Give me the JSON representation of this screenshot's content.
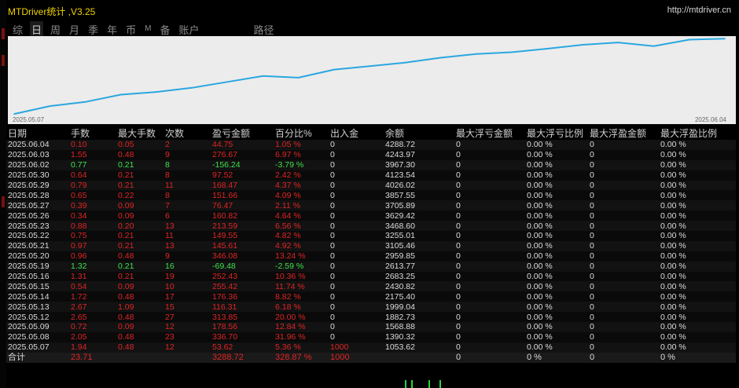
{
  "app": {
    "title": "MTDriver统计 ,V3.25",
    "site": "http://mtdriver.cn"
  },
  "tabs": [
    "综",
    "日",
    "周",
    "月",
    "季",
    "年",
    "币",
    "M",
    "备",
    "账户",
    "路径"
  ],
  "active_tab": "日",
  "chart_data": {
    "type": "line",
    "title": "",
    "x_start_label": "2025.05.07",
    "x_end_label": "2025.06.04",
    "x": [
      "2025.05.07",
      "2025.05.08",
      "2025.05.09",
      "2025.05.12",
      "2025.05.13",
      "2025.05.14",
      "2025.05.15",
      "2025.05.16",
      "2025.05.19",
      "2025.05.20",
      "2025.05.21",
      "2025.05.22",
      "2025.05.23",
      "2025.05.26",
      "2025.05.27",
      "2025.05.28",
      "2025.05.29",
      "2025.05.30",
      "2025.06.02",
      "2025.06.03",
      "2025.06.04"
    ],
    "values": [
      1053.62,
      1390.32,
      1568.88,
      1882.73,
      1999.04,
      2175.4,
      2430.82,
      2683.25,
      2613.77,
      2959.85,
      3105.46,
      3255.01,
      3468.6,
      3629.42,
      3705.89,
      3857.55,
      4026.02,
      4123.54,
      3967.3,
      4243.97,
      4288.72
    ],
    "line_color": "#2aa7e0",
    "background": "#ececec"
  },
  "table": {
    "columns": [
      "日期",
      "手数",
      "最大手数",
      "次数",
      "盈亏金额",
      "百分比%",
      "出入金",
      "余额",
      "最大浮亏金额",
      "最大浮亏比例",
      "最大浮盈金额",
      "最大浮盈比例"
    ],
    "rows": [
      [
        "2025.06.04",
        "0.10",
        "0.05",
        "2",
        "44.75",
        "1.05 %",
        "0",
        "4288.72",
        "0",
        "0.00 %",
        "0",
        "0.00 %"
      ],
      [
        "2025.06.03",
        "1.55",
        "0.48",
        "9",
        "276.67",
        "6.97 %",
        "0",
        "4243.97",
        "0",
        "0.00 %",
        "0",
        "0.00 %"
      ],
      [
        "2025.06.02",
        "0.77",
        "0.21",
        "8",
        "-156.24",
        "-3.79 %",
        "0",
        "3967.30",
        "0",
        "0.00 %",
        "0",
        "0.00 %"
      ],
      [
        "2025.05.30",
        "0.64",
        "0.21",
        "8",
        "97.52",
        "2.42 %",
        "0",
        "4123.54",
        "0",
        "0.00 %",
        "0",
        "0.00 %"
      ],
      [
        "2025.05.29",
        "0.79",
        "0.21",
        "11",
        "168.47",
        "4.37 %",
        "0",
        "4026.02",
        "0",
        "0.00 %",
        "0",
        "0.00 %"
      ],
      [
        "2025.05.28",
        "0.65",
        "0.22",
        "8",
        "151.66",
        "4.09 %",
        "0",
        "3857.55",
        "0",
        "0.00 %",
        "0",
        "0.00 %"
      ],
      [
        "2025.05.27",
        "0.39",
        "0.09",
        "7",
        "76.47",
        "2.11 %",
        "0",
        "3705.89",
        "0",
        "0.00 %",
        "0",
        "0.00 %"
      ],
      [
        "2025.05.26",
        "0.34",
        "0.09",
        "6",
        "160.82",
        "4.64 %",
        "0",
        "3629.42",
        "0",
        "0.00 %",
        "0",
        "0.00 %"
      ],
      [
        "2025.05.23",
        "0.88",
        "0.20",
        "13",
        "213.59",
        "6.56 %",
        "0",
        "3468.60",
        "0",
        "0.00 %",
        "0",
        "0.00 %"
      ],
      [
        "2025.05.22",
        "0.75",
        "0.21",
        "11",
        "149.55",
        "4.82 %",
        "0",
        "3255.01",
        "0",
        "0.00 %",
        "0",
        "0.00 %"
      ],
      [
        "2025.05.21",
        "0.97",
        "0.21",
        "13",
        "145.61",
        "4.92 %",
        "0",
        "3105.46",
        "0",
        "0.00 %",
        "0",
        "0.00 %"
      ],
      [
        "2025.05.20",
        "0.96",
        "0.48",
        "9",
        "346.08",
        "13.24 %",
        "0",
        "2959.85",
        "0",
        "0.00 %",
        "0",
        "0.00 %"
      ],
      [
        "2025.05.19",
        "1.32",
        "0.21",
        "16",
        "-69.48",
        "-2.59 %",
        "0",
        "2613.77",
        "0",
        "0.00 %",
        "0",
        "0.00 %"
      ],
      [
        "2025.05.16",
        "1.31",
        "0.21",
        "19",
        "252.43",
        "10.36 %",
        "0",
        "2683.25",
        "0",
        "0.00 %",
        "0",
        "0.00 %"
      ],
      [
        "2025.05.15",
        "0.54",
        "0.09",
        "10",
        "255.42",
        "11.74 %",
        "0",
        "2430.82",
        "0",
        "0.00 %",
        "0",
        "0.00 %"
      ],
      [
        "2025.05.14",
        "1.72",
        "0.48",
        "17",
        "176.36",
        "8.82 %",
        "0",
        "2175.40",
        "0",
        "0.00 %",
        "0",
        "0.00 %"
      ],
      [
        "2025.05.13",
        "2.67",
        "1.09",
        "15",
        "116.31",
        "6.18 %",
        "0",
        "1999.04",
        "0",
        "0.00 %",
        "0",
        "0.00 %"
      ],
      [
        "2025.05.12",
        "2.65",
        "0.48",
        "27",
        "313.85",
        "20.00 %",
        "0",
        "1882.73",
        "0",
        "0.00 %",
        "0",
        "0.00 %"
      ],
      [
        "2025.05.09",
        "0.72",
        "0.09",
        "12",
        "178.56",
        "12.84 %",
        "0",
        "1568.88",
        "0",
        "0.00 %",
        "0",
        "0.00 %"
      ],
      [
        "2025.05.08",
        "2.05",
        "0.48",
        "23",
        "336.70",
        "31.96 %",
        "0",
        "1390.32",
        "0",
        "0.00 %",
        "0",
        "0.00 %"
      ],
      [
        "2025.05.07",
        "1.94",
        "0.48",
        "12",
        "53.62",
        "5.36 %",
        "1000",
        "1053.62",
        "0",
        "0.00 %",
        "0",
        "0.00 %"
      ]
    ],
    "row_colors": [
      "red",
      "red",
      "green",
      "red",
      "red",
      "red",
      "red",
      "red",
      "red",
      "red",
      "red",
      "red",
      "green",
      "red",
      "red",
      "red",
      "red",
      "red",
      "red",
      "red",
      "red"
    ],
    "total": {
      "label": "合计",
      "lots": "23.71",
      "pnl": "3288.72",
      "percent": "328.87 %",
      "deposit": "1000",
      "max_float_loss": "0",
      "max_float_loss_pct": "0 %",
      "max_float_profit": "0",
      "max_float_profit_pct": "0 %"
    },
    "colors": {
      "profit": "#e02424",
      "loss": "#3fe04a"
    }
  }
}
